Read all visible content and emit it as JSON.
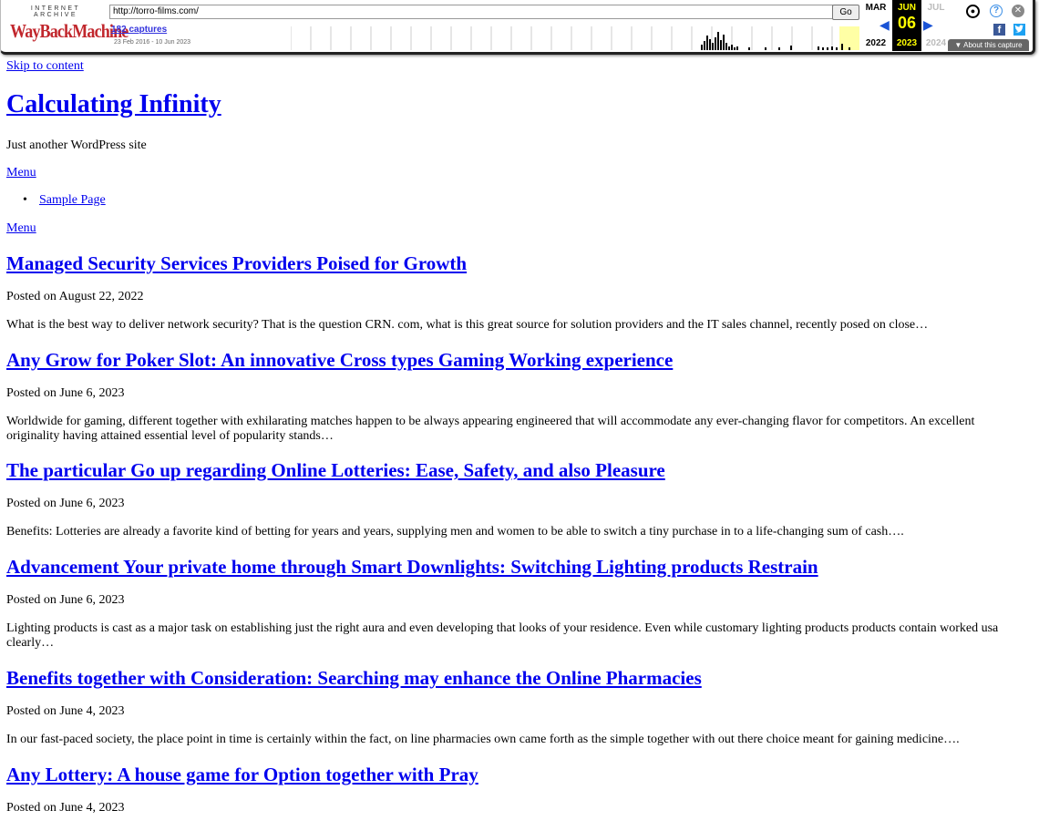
{
  "wayback": {
    "logo_top": "INTERNET ARCHIVE",
    "logo_main": "WayBackMachine",
    "url": "http://torro-films.com/",
    "go_label": "Go",
    "captures": "182 captures",
    "date_range": "23 Feb 2016 - 10 Jun 2023",
    "months": {
      "prev": "MAR",
      "current": "JUN",
      "next": "JUL"
    },
    "day": "06",
    "years": {
      "prev": "2022",
      "current": "2023",
      "next": "2024"
    },
    "about": "About this capture",
    "icons": [
      "user-icon",
      "help-icon",
      "close-icon",
      "facebook-icon",
      "twitter-icon"
    ]
  },
  "site": {
    "skip": "Skip to content",
    "title": "Calculating Infinity",
    "description": "Just another WordPress site",
    "menu_label": "Menu",
    "nav_items": [
      "Sample Page"
    ],
    "menu_label_2": "Menu"
  },
  "posts": [
    {
      "title": "Managed Security Services Providers Poised for Growth",
      "meta": "Posted on August 22, 2022",
      "excerpt": "What is the best way to deliver network security? That is the question CRN. com, what is this great source for solution providers and the IT sales channel, recently posed on close…"
    },
    {
      "title": "Any Grow for Poker Slot: An innovative Cross types Gaming Working experience",
      "meta": "Posted on June 6, 2023",
      "excerpt": "Worldwide for gaming, different together with exhilarating matches happen to be always appearing engineered that will accommodate any ever-changing flavor for competitors. An excellent originality having attained essential level of popularity stands…"
    },
    {
      "title": "The particular Go up regarding Online Lotteries: Ease, Safety, and also Pleasure",
      "meta": "Posted on June 6, 2023",
      "excerpt": "Benefits: Lotteries are already a favorite kind of betting for years and years, supplying men and women to be able to switch a tiny purchase in to a life-changing sum of cash…."
    },
    {
      "title": "Advancement Your private home through Smart Downlights: Switching Lighting products Restrain",
      "meta": "Posted on June 6, 2023",
      "excerpt": "Lighting products is cast as a major task on establishing just the right aura and even developing that looks of your residence. Even while customary lighting products products contain worked usa clearly…"
    },
    {
      "title": "Benefits together with Consideration: Searching may enhance the Online Pharmacies",
      "meta": "Posted on June 4, 2023",
      "excerpt": "In our fast-paced society, the place point in time is certainly within the fact, on line pharmacies own came forth as the simple together with out there choice meant for gaining medicine…."
    },
    {
      "title": "Any Lottery: A house game for Option together with Pray",
      "meta": "Posted on June 4, 2023",
      "excerpt": ""
    }
  ]
}
